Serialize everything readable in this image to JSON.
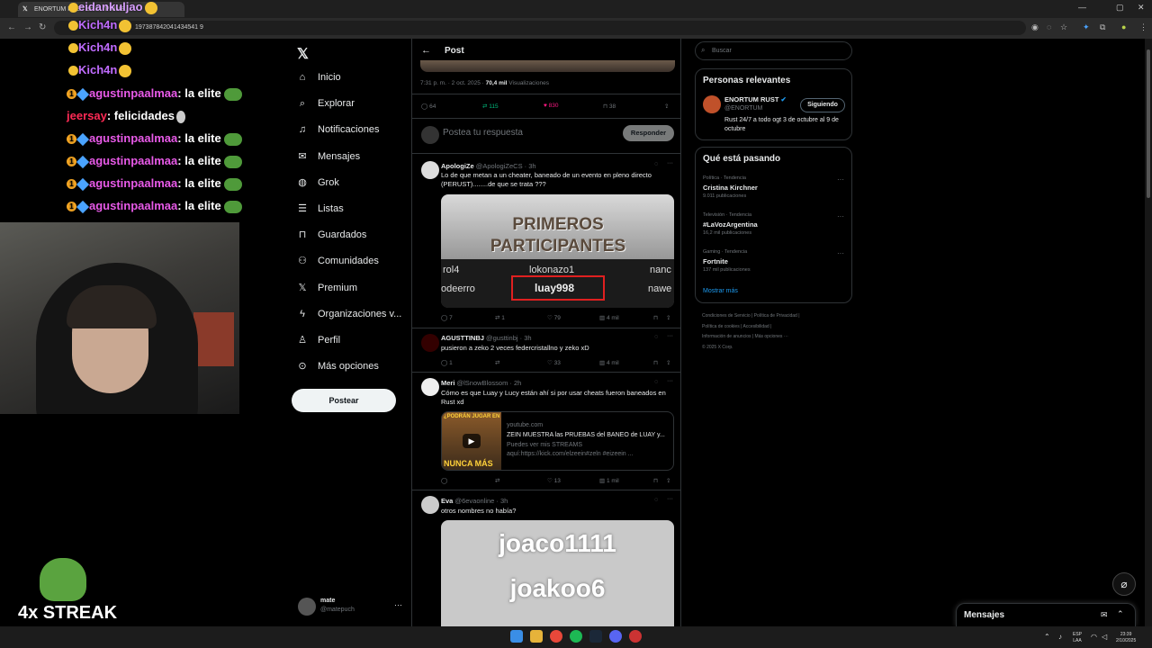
{
  "browser": {
    "tab_title": "ENORTUM RUST en X: \"PRIME...",
    "url": "197387842041434541 9"
  },
  "stream": {
    "chat": [
      {
        "user": "eidankuljao",
        "msg": "",
        "color": "#d9a0ff"
      },
      {
        "user": "Kich4n",
        "msg": "",
        "color": "#c06cff"
      },
      {
        "user": "Kich4n",
        "msg": "",
        "color": "#c06cff"
      },
      {
        "user": "Kich4n",
        "msg": "",
        "color": "#c06cff"
      },
      {
        "user": "agustinpaalmaa",
        "msg": ": la elite",
        "color": "#e85ae8"
      },
      {
        "user": "jeersay",
        "msg": ": felicidades",
        "color": "#ff2a55"
      },
      {
        "user": "agustinpaalmaa",
        "msg": ": la elite",
        "color": "#e85ae8"
      },
      {
        "user": "agustinpaalmaa",
        "msg": ": la elite",
        "color": "#e85ae8"
      },
      {
        "user": "agustinpaalmaa",
        "msg": ": la elite",
        "color": "#e85ae8"
      },
      {
        "user": "agustinpaalmaa",
        "msg": ": la elite",
        "color": "#e85ae8"
      }
    ],
    "streak_label": "4x STREAK"
  },
  "nav": {
    "items": [
      {
        "label": "Inicio",
        "icon": "home-icon"
      },
      {
        "label": "Explorar",
        "icon": "search-icon"
      },
      {
        "label": "Notificaciones",
        "icon": "bell-icon"
      },
      {
        "label": "Mensajes",
        "icon": "mail-icon"
      },
      {
        "label": "Grok",
        "icon": "grok-icon"
      },
      {
        "label": "Listas",
        "icon": "list-icon"
      },
      {
        "label": "Guardados",
        "icon": "bookmark-icon"
      },
      {
        "label": "Comunidades",
        "icon": "people-icon"
      },
      {
        "label": "Premium",
        "icon": "x-icon"
      },
      {
        "label": "Organizaciones v...",
        "icon": "lightning-icon"
      },
      {
        "label": "Perfil",
        "icon": "person-icon"
      },
      {
        "label": "Más opciones",
        "icon": "more-circle-icon"
      }
    ],
    "post_button": "Postear",
    "account": {
      "name": "mate",
      "handle": "@matepuch"
    }
  },
  "post": {
    "header": "Post",
    "meta_time": "7:31 p. m. · 2 oct. 2025 · ",
    "meta_views": "70,4 mil",
    "meta_views_label": " Visualizaciones",
    "replies": "64",
    "reposts": "115",
    "likes": "830",
    "bookmarks": "38",
    "reply_placeholder": "Postea tu respuesta",
    "reply_button": "Responder"
  },
  "replies": [
    {
      "name": "ApologiZe",
      "handle": "@ApologiZeCS · 3h",
      "text": "Lo de que metan a un cheater, baneado de un evento en pleno directo (PERUST)........de que se trata ???",
      "image_title": "PRIMEROS PARTICIPANTES",
      "image_names": [
        "rol4",
        "lokonazo1",
        "nanc",
        "odeerro",
        "luay998",
        "nawe"
      ],
      "stats": {
        "replies": "7",
        "reposts": "1",
        "likes": "79",
        "views": "4 mil"
      }
    },
    {
      "name": "AGUSTTINBJ",
      "handle": "@gusttinbj · 3h",
      "text": "pusieron a zeko 2 veces federcristallno y zeko xD",
      "stats": {
        "replies": "1",
        "reposts": "",
        "likes": "33",
        "views": "4 mil"
      }
    },
    {
      "name": "Meri",
      "handle": "@lSnowBlossom · 2h",
      "text": "Cómo es que Luay y Lucy están ahí si por usar cheats fueron baneados en Rust xd",
      "card": {
        "domain": "youtube.com",
        "title": "ZEIN MUESTRA las PRUEBAS del BANEO de LUAY y...",
        "desc1": "Puedes ver mis STREAMS",
        "desc2": "aquí:https://kick.com/elzeein#zeln #eizeein ...",
        "thumb_top": "¿PODRÁN JUGAR EN",
        "thumb_bottom": "NUNCA MÁS"
      },
      "stats": {
        "replies": "",
        "reposts": "",
        "likes": "13",
        "views": "1 mil"
      }
    },
    {
      "name": "Eva",
      "handle": "@6evaonline · 3h",
      "text": "otros nombres no había?",
      "image_names": [
        "joaco1111",
        "joakoo6"
      ]
    }
  ],
  "right": {
    "search_placeholder": "Buscar",
    "relevant_title": "Personas relevantes",
    "relevant": {
      "name": "ENORTUM RUST",
      "handle": "@ENORTUM",
      "bio": "Rust 24/7 a todo ogt 3 de octubre al 9 de octubre",
      "button": "Siguiendo"
    },
    "trends_title": "Qué está pasando",
    "trends": [
      {
        "category": "Política · Tendencia",
        "name": "Cristina Kirchner",
        "count": "9.011 publicaciones"
      },
      {
        "category": "Televisión · Tendencia",
        "name": "#LaVozArgentina",
        "count": "16,2 mil publicaciones"
      },
      {
        "category": "Gaming · Tendencia",
        "name": "Fortnite",
        "count": "137 mil publicaciones"
      }
    ],
    "show_more": "Mostrar más",
    "footer": [
      "Condiciones de Servicio  |   Política de Privacidad   |",
      "Política de cookies   |   Accesibilidad   |",
      "Información de anuncios   |   Más opciones ···",
      "© 2025 X Corp."
    ],
    "messages_label": "Mensajes"
  },
  "taskbar": {
    "lang1": "ESP",
    "lang2": "LAA",
    "time": "23:39",
    "date": "2/10/2025"
  },
  "colors": {
    "accent": "#1d9bf0",
    "like": "#f91880",
    "repost": "#00ba7c"
  }
}
